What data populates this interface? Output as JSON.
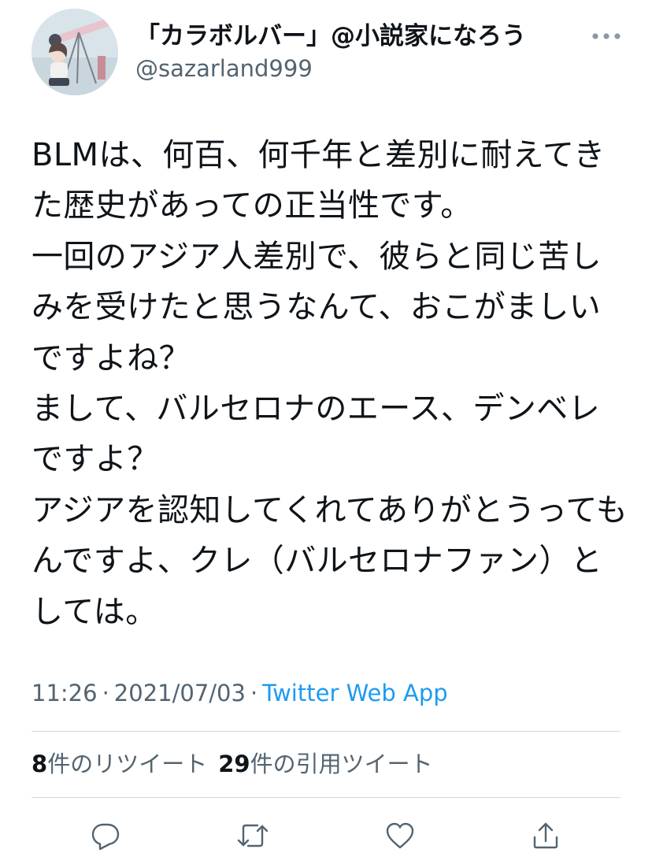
{
  "tweet": {
    "author": {
      "display_name": "「カラボルバー」@小説家になろう",
      "handle": "@sazarland999"
    },
    "text": "BLMは、何百、何千年と差別に耐えてきた歴史があっての正当性です。\n一回のアジア人差別で、彼らと同じ苦しみを受けたと思うなんて、おこがましいですよね？\nまして、バルセロナのエース、デンベレですよ？\nアジアを認知してくれてありがとうってもんですよ、クレ（バルセロナファン）としては。",
    "time": "11:26",
    "date": "2021/07/03",
    "separator": "·",
    "source": "Twitter Web App",
    "stats": {
      "retweets_count": "8",
      "retweets_label": "件のリツイート",
      "quotes_count": "29",
      "quotes_label": "件の引用ツイート"
    }
  },
  "icons": {
    "more": "more-dots-icon",
    "reply": "reply-icon",
    "retweet": "retweet-icon",
    "like": "heart-icon",
    "share": "share-icon"
  },
  "colors": {
    "link": "#1d9bf0",
    "secondary_text": "#536471",
    "primary_text": "#0f1419",
    "divider": "#cfd9de"
  }
}
